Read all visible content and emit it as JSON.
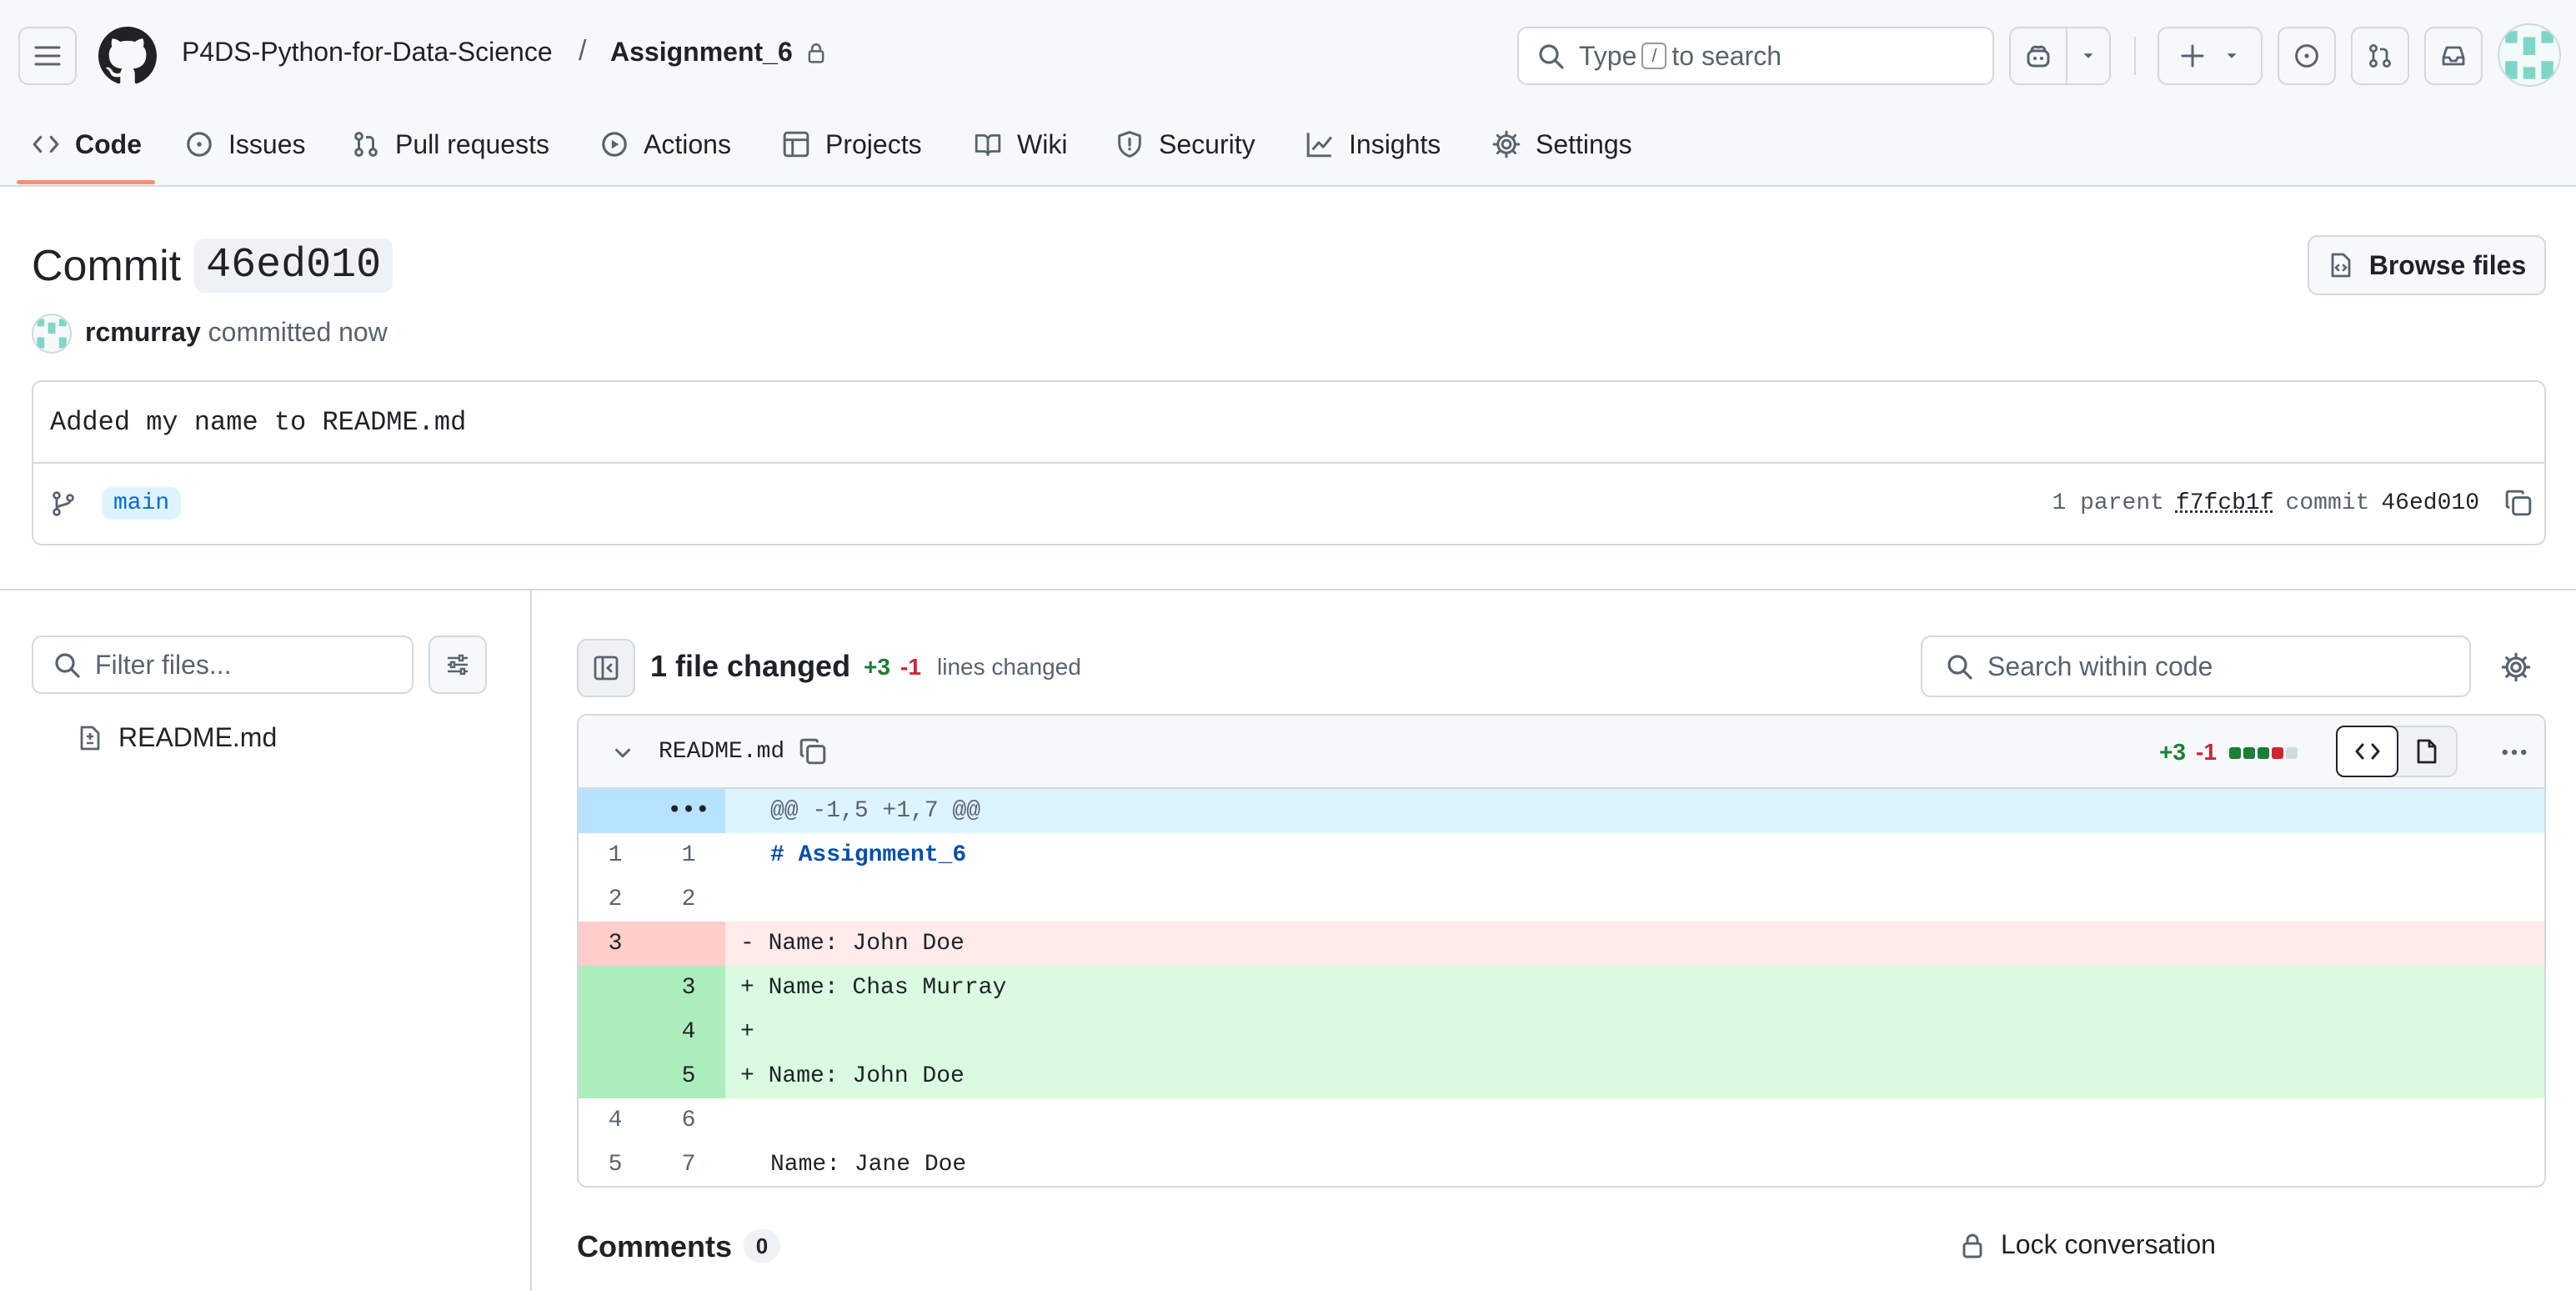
{
  "header": {
    "repo_owner": "P4DS-Python-for-Data-Science",
    "separator": "/",
    "repo_name": "Assignment_6",
    "search": {
      "before": "Type",
      "key": "/",
      "after": "to search"
    }
  },
  "tabs": [
    {
      "label": "Code",
      "icon": "code-icon",
      "active": true
    },
    {
      "label": "Issues",
      "icon": "issue-opened-icon"
    },
    {
      "label": "Pull requests",
      "icon": "git-pull-request-icon"
    },
    {
      "label": "Actions",
      "icon": "play-icon"
    },
    {
      "label": "Projects",
      "icon": "table-icon"
    },
    {
      "label": "Wiki",
      "icon": "book-icon"
    },
    {
      "label": "Security",
      "icon": "shield-icon"
    },
    {
      "label": "Insights",
      "icon": "graph-icon"
    },
    {
      "label": "Settings",
      "icon": "gear-icon"
    }
  ],
  "commit": {
    "title_prefix": "Commit",
    "sha_short": "46ed010",
    "browse_label": "Browse files",
    "author": "rcmurray",
    "committed_text": "committed now",
    "message": "Added my name to README.md",
    "branch": "main",
    "parent_label": "1 parent",
    "parent_sha": "f7fcb1f",
    "commit_label": "commit",
    "commit_sha": "46ed010"
  },
  "sidebar": {
    "filter_placeholder": "Filter files...",
    "files": [
      {
        "name": "README.md",
        "icon": "file-diff-icon"
      }
    ]
  },
  "diff_toolbar": {
    "files_changed": "1 file changed",
    "additions": "+3",
    "deletions": "-1",
    "lines_changed_label": "lines changed",
    "search_placeholder": "Search within code"
  },
  "diff_file": {
    "filename": "README.md",
    "additions": "+3",
    "deletions": "-1",
    "stat_boxes": [
      "add",
      "add",
      "add",
      "del",
      "neutral"
    ],
    "colors": {
      "add": "#1a7f37",
      "del": "#d1242f",
      "neutral": "#d1d9e0"
    },
    "rows": [
      {
        "type": "hunk",
        "old": "",
        "new": "•••",
        "text": "@@ -1,5 +1,7 @@"
      },
      {
        "type": "context",
        "old": "1",
        "new": "1",
        "text": "# Assignment_6",
        "heading": true
      },
      {
        "type": "context",
        "old": "2",
        "new": "2",
        "text": ""
      },
      {
        "type": "del",
        "old": "3",
        "new": "",
        "text": "- Name: John Doe"
      },
      {
        "type": "add",
        "old": "",
        "new": "3",
        "text": "+ Name: Chas Murray"
      },
      {
        "type": "add",
        "old": "",
        "new": "4",
        "text": "+"
      },
      {
        "type": "add",
        "old": "",
        "new": "5",
        "text": "+ Name: John Doe"
      },
      {
        "type": "context",
        "old": "4",
        "new": "6",
        "text": ""
      },
      {
        "type": "context",
        "old": "5",
        "new": "7",
        "text": "Name: Jane Doe"
      }
    ]
  },
  "comments": {
    "title": "Comments",
    "count": "0",
    "lock_label": "Lock conversation"
  }
}
